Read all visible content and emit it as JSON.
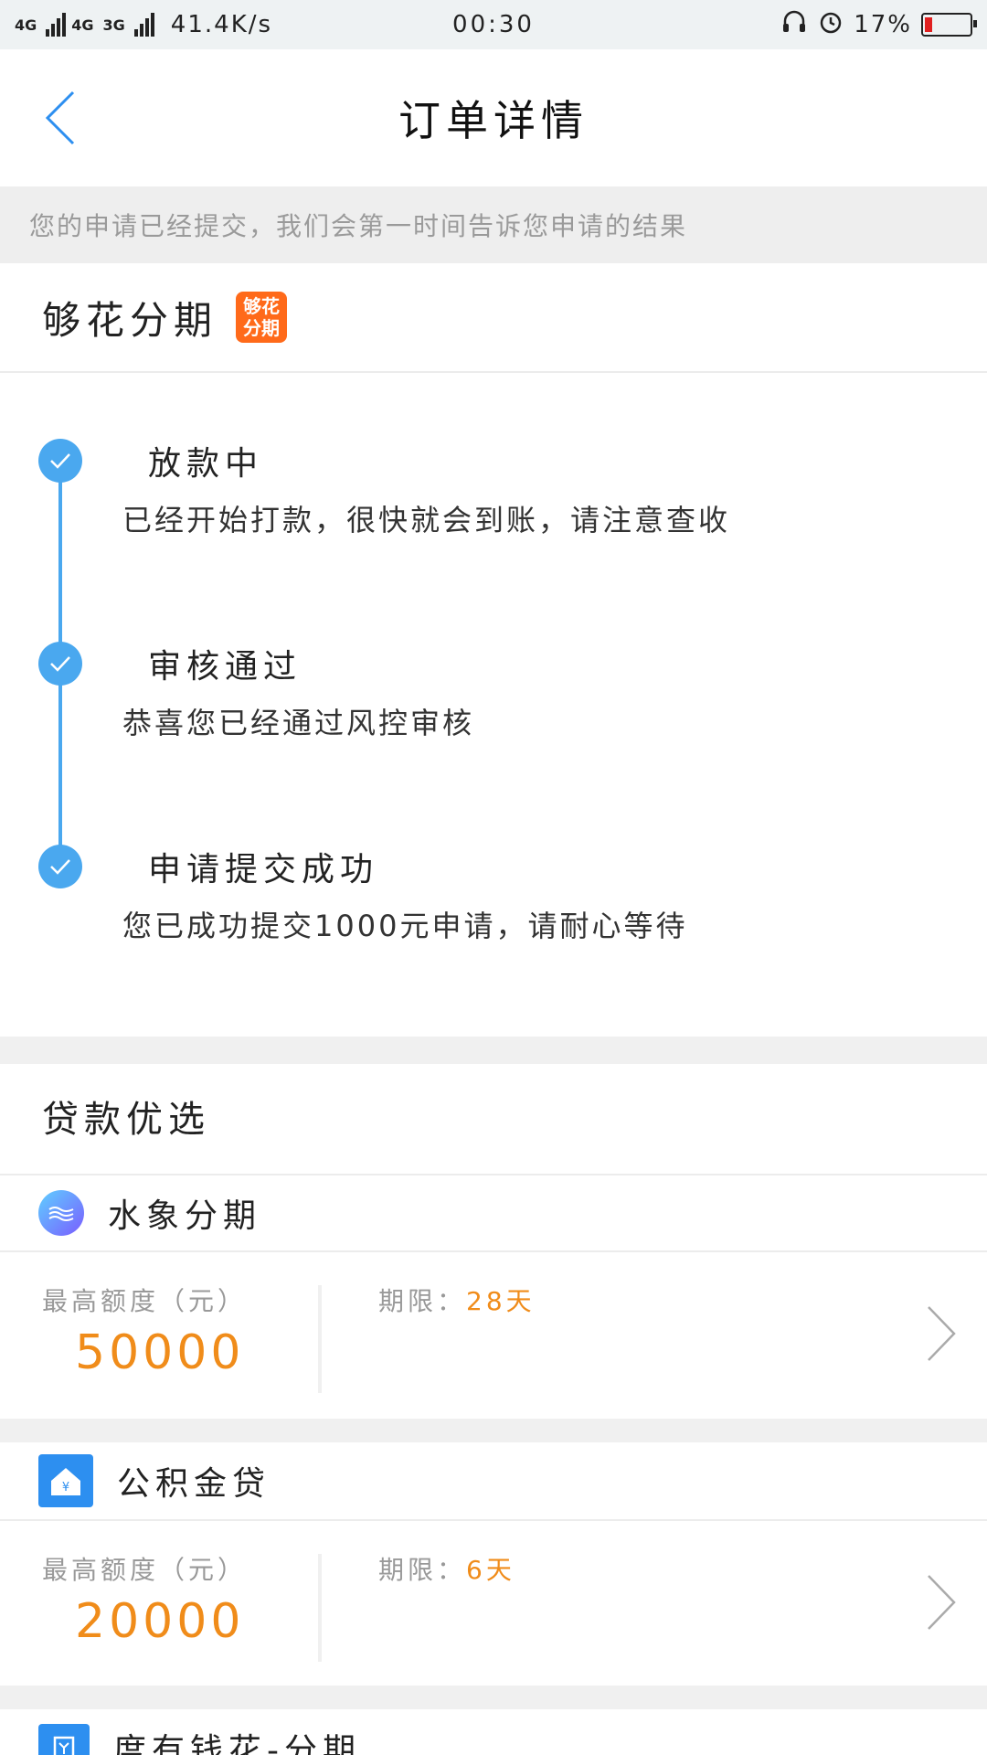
{
  "status_bar": {
    "network_left": "4G",
    "network_left2": "4G",
    "network_3g": "3G",
    "speed": "41.4K/s",
    "time": "00:30",
    "battery": "17%",
    "battery_level": 0.17
  },
  "header": {
    "title": "订单详情"
  },
  "notice": {
    "text": "您的申请已经提交，我们会第一时间告诉您申请的结果"
  },
  "provider": {
    "name": "够花分期",
    "logo_text": "够花分期"
  },
  "timeline": {
    "steps": [
      {
        "title": "放款中",
        "desc": "已经开始打款，很快就会到账，请注意查收"
      },
      {
        "title": "审核通过",
        "desc": "恭喜您已经通过风控审核"
      },
      {
        "title": "申请提交成功",
        "desc": "您已成功提交1000元申请，请耐心等待"
      }
    ]
  },
  "loans": {
    "section_title": "贷款优选",
    "items": [
      {
        "name": "水象分期",
        "limit_label": "最高额度（元）",
        "limit_value": "50000",
        "term_label": "期限：",
        "term_value": "28天"
      },
      {
        "name": "公积金贷",
        "limit_label": "最高额度（元）",
        "limit_value": "20000",
        "term_label": "期限：",
        "term_value": "6天"
      },
      {
        "name": "度有钱花-分期"
      }
    ]
  },
  "colors": {
    "accent": "#4aa8ef",
    "orange": "#f08c1a",
    "icon_blue": "#2d8ff0"
  }
}
